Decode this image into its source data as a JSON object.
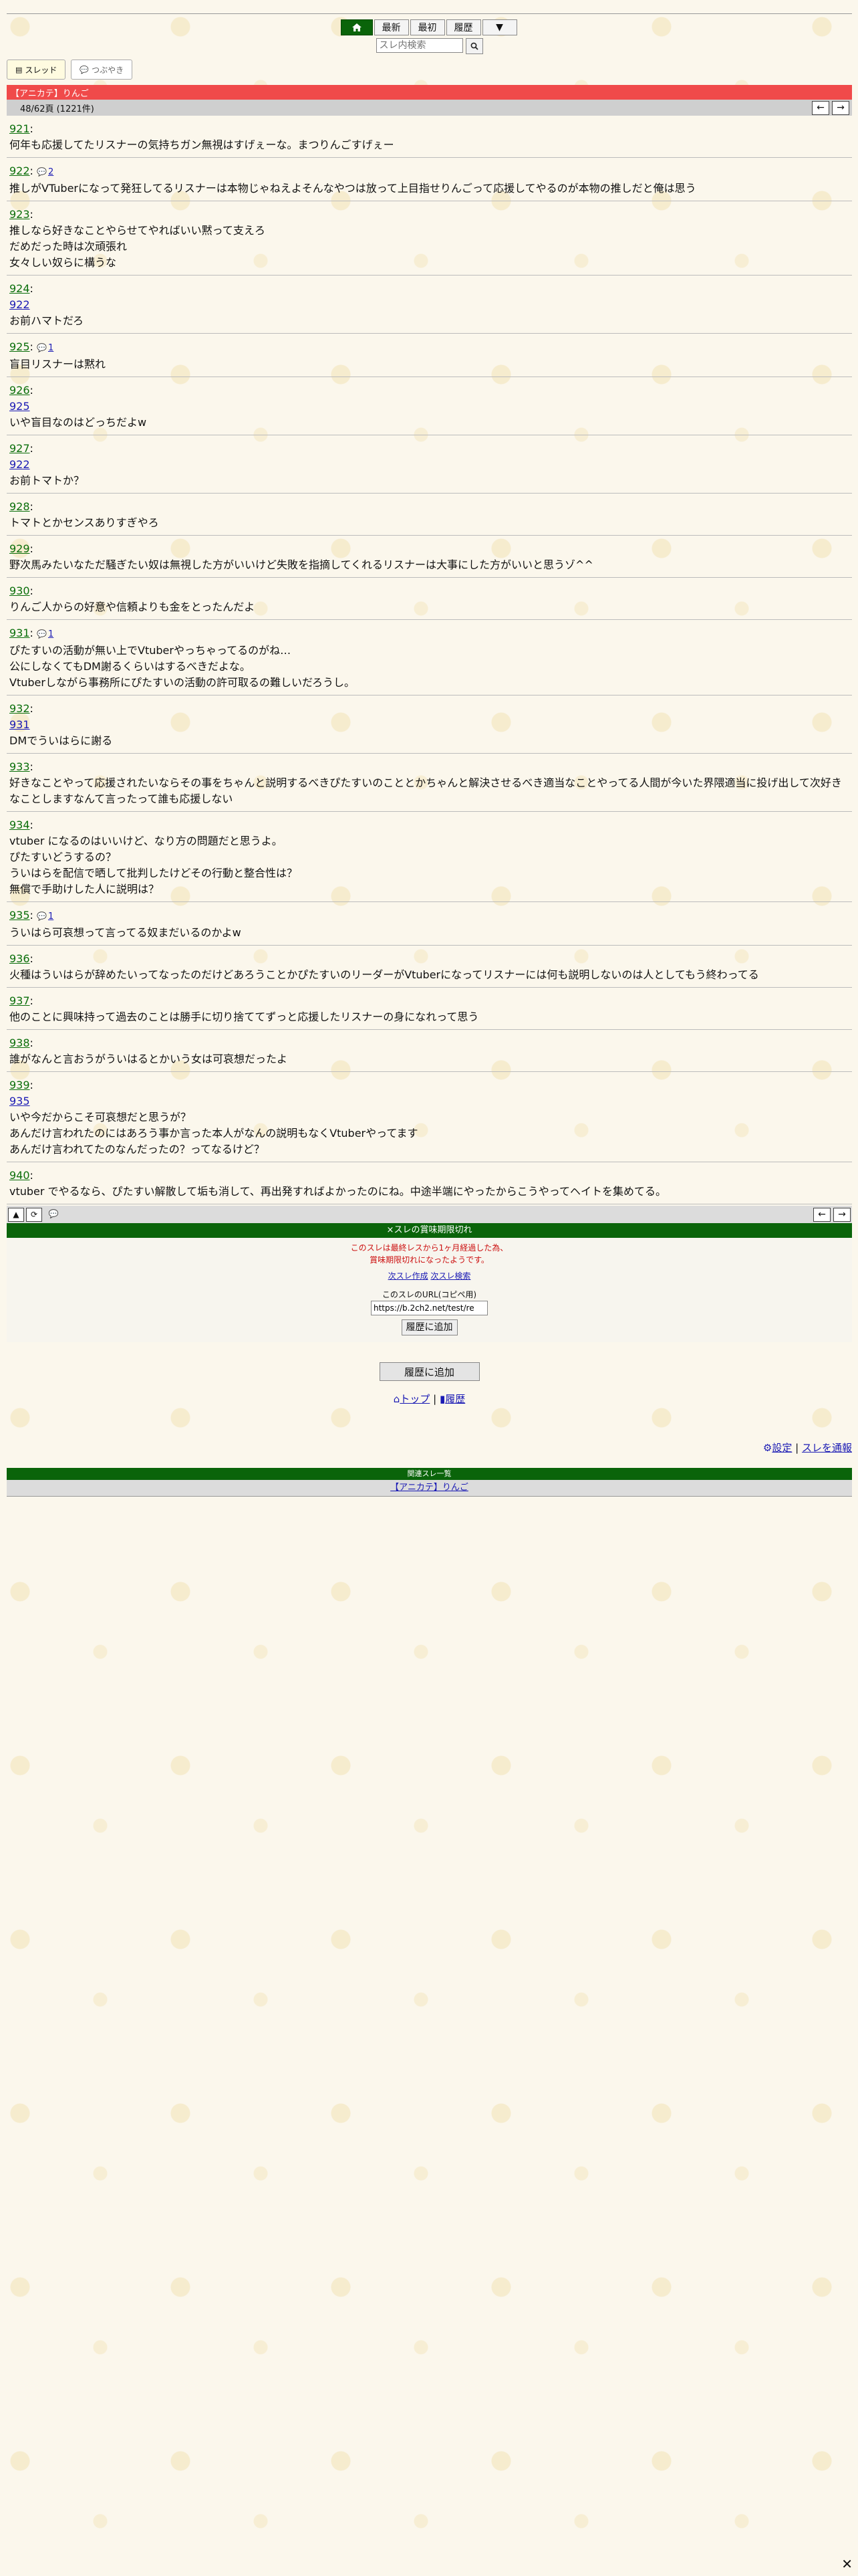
{
  "nav": {
    "items": [
      "最新",
      "最初",
      "履歴",
      "▼"
    ],
    "search_placeholder": "スレ内検索"
  },
  "tabs": {
    "thread": "スレッド",
    "tweet": "つぶやき"
  },
  "thread": {
    "title": "【アニカテ】りんご",
    "page_info": "48/62頁 (1221件)"
  },
  "posts": [
    {
      "num": "921",
      "replies": "",
      "anchor": "",
      "lines": [
        "何年も応援してたリスナーの気持ちガン無視はすげぇーな。まつりんごすげぇー"
      ]
    },
    {
      "num": "922",
      "replies": "2",
      "anchor": "",
      "lines": [
        "推しがVTuberになって発狂してるリスナーは本物じゃねえよそんなやつは放って上目指せりんごって応援してやるのが本物の推しだと俺は思う"
      ]
    },
    {
      "num": "923",
      "replies": "",
      "anchor": "",
      "lines": [
        "推しなら好きなことやらせてやればいい黙って支えろ",
        "だめだった時は次頑張れ",
        "女々しい奴らに構うな"
      ]
    },
    {
      "num": "924",
      "replies": "",
      "anchor": "922",
      "lines": [
        "お前ハマトだろ"
      ]
    },
    {
      "num": "925",
      "replies": "1",
      "anchor": "",
      "lines": [
        "盲目リスナーは黙れ"
      ]
    },
    {
      "num": "926",
      "replies": "",
      "anchor": "925",
      "lines": [
        "いや盲目なのはどっちだよw"
      ]
    },
    {
      "num": "927",
      "replies": "",
      "anchor": "922",
      "lines": [
        "お前トマトか？"
      ]
    },
    {
      "num": "928",
      "replies": "",
      "anchor": "",
      "lines": [
        "トマトとかセンスありすぎやろ"
      ]
    },
    {
      "num": "929",
      "replies": "",
      "anchor": "",
      "lines": [
        "野次馬みたいなただ騒ぎたい奴は無視した方がいいけど失敗を指摘してくれるリスナーは大事にした方がいいと思うゾ^^"
      ]
    },
    {
      "num": "930",
      "replies": "",
      "anchor": "",
      "lines": [
        "りんご人からの好意や信頼よりも金をとったんだよ"
      ]
    },
    {
      "num": "931",
      "replies": "1",
      "anchor": "",
      "lines": [
        "ぴたすいの活動が無い上でVtuberやっちゃってるのがね…",
        "公にしなくてもDM謝るくらいはするべきだよな。",
        "Vtuberしながら事務所にぴたすいの活動の許可取るの難しいだろうし。"
      ]
    },
    {
      "num": "932",
      "replies": "",
      "anchor": "931",
      "lines": [
        "DMでういはらに謝る"
      ]
    },
    {
      "num": "933",
      "replies": "",
      "anchor": "",
      "lines": [
        "好きなことやって応援されたいならその事をちゃんと説明するべきぴたすいのこととかちゃんと解決させるべき適当なことやってる人間が今いた界隈適当に投げ出して次好き",
        "なことしますなんて言ったって誰も応援しない"
      ]
    },
    {
      "num": "934",
      "replies": "",
      "anchor": "",
      "lines": [
        "vtuber になるのはいいけど、なり方の問題だと思うよ。",
        "ぴたすいどうするの？",
        "ういはらを配信で晒して批判したけどその行動と整合性は？",
        "無償で手助けした人に説明は？"
      ]
    },
    {
      "num": "935",
      "replies": "1",
      "anchor": "",
      "lines": [
        "ういはら可哀想って言ってる奴まだいるのかよw"
      ]
    },
    {
      "num": "936",
      "replies": "",
      "anchor": "",
      "lines": [
        "火種はういはらが辞めたいってなったのだけどあろうことかぴたすいのリーダーがVtuberになってリスナーには何も説明しないのは人としてもう終わってる"
      ]
    },
    {
      "num": "937",
      "replies": "",
      "anchor": "",
      "lines": [
        "他のことに興味持って過去のことは勝手に切り捨ててずっと応援したリスナーの身になれって思う"
      ]
    },
    {
      "num": "938",
      "replies": "",
      "anchor": "",
      "lines": [
        "誰がなんと言おうがういはるとかいう女は可哀想だったよ"
      ]
    },
    {
      "num": "939",
      "replies": "",
      "anchor": "935",
      "lines": [
        "いや今だからこそ可哀想だと思うが？",
        "あんだけ言われたのにはあろう事か言った本人がなんの説明もなくVtuberやってます",
        "あんだけ言われてたのなんだったの？ってなるけど？"
      ]
    },
    {
      "num": "940",
      "replies": "",
      "anchor": "",
      "lines": [
        "vtuber でやるなら、ぴたすい解散して垢も消して、再出発すればよかったのにね。中途半端にやったからこうやってヘイトを集めてる。"
      ]
    }
  ],
  "notice": {
    "header": "×スレの賞味期限切れ",
    "line1": "このスレは最終レスから1ヶ月経過した為、",
    "line2": "賞味期限切れになったようです。",
    "link1": "次スレ作成",
    "link2": "次スレ検索",
    "url_label": "このスレのURL(コピペ用)",
    "url_value": "https://b.2ch2.net/test/re",
    "history_button": "履歴に追加"
  },
  "footer": {
    "add_history": "履歴に追加",
    "top": "トップ",
    "history": "履歴",
    "settings": "設定",
    "report": "スレを通報",
    "related_header": "関連スレ一覧",
    "related_link": "【アニカテ】りんご"
  }
}
